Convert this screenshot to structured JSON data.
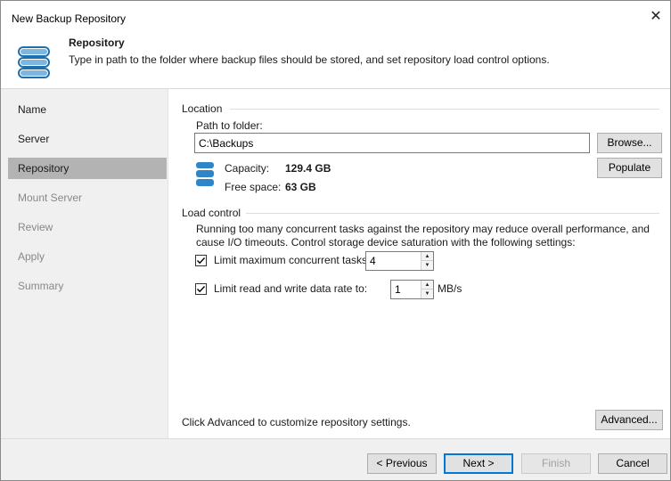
{
  "window": {
    "title": "New Backup Repository",
    "close_glyph": "✕"
  },
  "header": {
    "icon": "database-icon",
    "title": "Repository",
    "description": "Type in path to the folder where backup files should be stored, and set repository load control options."
  },
  "sidebar": {
    "items": [
      {
        "label": "Name",
        "state": "normal"
      },
      {
        "label": "Server",
        "state": "normal"
      },
      {
        "label": "Repository",
        "state": "active"
      },
      {
        "label": "Mount Server",
        "state": "disabled"
      },
      {
        "label": "Review",
        "state": "disabled"
      },
      {
        "label": "Apply",
        "state": "disabled"
      },
      {
        "label": "Summary",
        "state": "disabled"
      }
    ]
  },
  "location": {
    "group_label": "Location",
    "path_label": "Path to folder:",
    "path_value": "C:\\Backups",
    "browse_label": "Browse...",
    "populate_label": "Populate",
    "storage_icon": "storage-icon",
    "capacity_label": "Capacity:",
    "capacity_value": "129.4 GB",
    "free_label": "Free space:",
    "free_value": "63 GB"
  },
  "load_control": {
    "group_label": "Load control",
    "description_line1": "Running too many concurrent tasks against the repository may reduce overall performance, and",
    "description_line2": "cause I/O timeouts. Control storage device saturation with the following settings:",
    "limit_tasks_label": "Limit maximum concurrent tasks to:",
    "limit_tasks_checked": true,
    "limit_tasks_value": "4",
    "limit_rate_label": "Limit read and write data rate to:",
    "limit_rate_checked": true,
    "limit_rate_value": "1",
    "limit_rate_unit": "MB/s"
  },
  "advanced": {
    "hint": "Click Advanced to customize repository settings.",
    "button_label": "Advanced..."
  },
  "footer": {
    "previous_label": "< Previous",
    "next_label": "Next >",
    "finish_label": "Finish",
    "cancel_label": "Cancel"
  },
  "colors": {
    "accent": "#0078d7",
    "db_icon_blue": "#2e86c8",
    "sidebar_bg": "#f0f0f0",
    "sidebar_active": "#b3b3b3"
  }
}
